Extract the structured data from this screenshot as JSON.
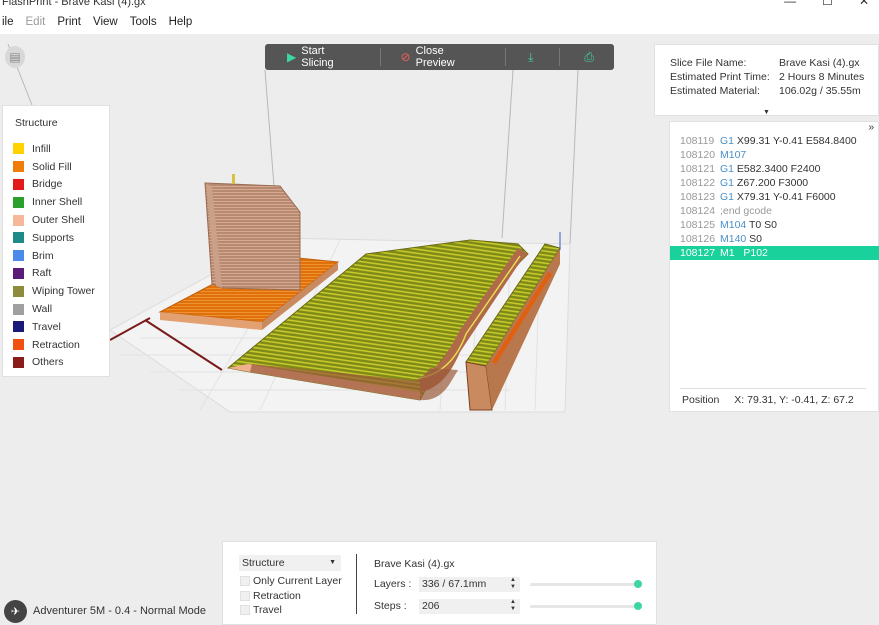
{
  "window": {
    "title": "FlashPrint - Brave Kasi (4).gx",
    "minimize": "—",
    "maximize": "☐",
    "close": "✕"
  },
  "menu": [
    {
      "label": "ile",
      "enabled": true
    },
    {
      "label": "Edit",
      "enabled": false
    },
    {
      "label": "Print",
      "enabled": true
    },
    {
      "label": "View",
      "enabled": true
    },
    {
      "label": "Tools",
      "enabled": true
    },
    {
      "label": "Help",
      "enabled": true
    }
  ],
  "toolbar": {
    "start_slicing": "Start Slicing",
    "close_preview": "Close Preview"
  },
  "structure": {
    "header": "Structure",
    "items": [
      {
        "label": "Infill",
        "color": "#ffd200"
      },
      {
        "label": "Solid Fill",
        "color": "#f07d0a"
      },
      {
        "label": "Bridge",
        "color": "#e31a1a"
      },
      {
        "label": "Inner Shell",
        "color": "#2ca02c"
      },
      {
        "label": "Outer Shell",
        "color": "#f7b89a"
      },
      {
        "label": "Supports",
        "color": "#1f8a8a"
      },
      {
        "label": "Brim",
        "color": "#4a8ae8"
      },
      {
        "label": "Raft",
        "color": "#5a1a78"
      },
      {
        "label": "Wiping Tower",
        "color": "#8c8c3c"
      },
      {
        "label": "Wall",
        "color": "#a0a0a0"
      },
      {
        "label": "Travel",
        "color": "#1a1a7a"
      },
      {
        "label": "Retraction",
        "color": "#f05010"
      },
      {
        "label": "Others",
        "color": "#8a1c1c"
      }
    ]
  },
  "slice_info": {
    "file_label": "Slice File Name:",
    "file_value": "Brave Kasi (4).gx",
    "time_label": "Estimated Print Time:",
    "time_value": "2 Hours 8 Minutes",
    "material_label": "Estimated Material:",
    "material_value": "106.02g / 35.55m"
  },
  "gcode": {
    "collapse": "»",
    "lines": [
      {
        "num": "108119",
        "cmd": "G1",
        "args": " X99.31 Y-0.41 E584.8400",
        "selected": false
      },
      {
        "num": "108120",
        "cmd": "M107",
        "args": "",
        "selected": false
      },
      {
        "num": "108121",
        "cmd": "G1",
        "args": " E582.3400 F2400",
        "selected": false
      },
      {
        "num": "108122",
        "cmd": "G1",
        "args": " Z67.200 F3000",
        "selected": false
      },
      {
        "num": "108123",
        "cmd": "G1",
        "args": " X79.31 Y-0.41 F6000",
        "selected": false
      },
      {
        "num": "108124",
        "cmd": "",
        "args": ";end gcode",
        "selected": false
      },
      {
        "num": "108125",
        "cmd": "M104",
        "args": " T0 S0",
        "selected": false
      },
      {
        "num": "108126",
        "cmd": "M140",
        "args": " S0",
        "selected": false
      },
      {
        "num": "108127",
        "cmd": "M1",
        "args": "   P102",
        "selected": true
      }
    ],
    "position_label": "Position",
    "position_value": "X: 79.31, Y: -0.41, Z: 67.2"
  },
  "bottom": {
    "view_mode": "Structure",
    "only_current_layer": "Only Current Layer",
    "retraction": "Retraction",
    "travel": "Travel",
    "file_name": "Brave Kasi (4).gx",
    "layers_label": "Layers :",
    "layers_value": "336 / 67.1mm",
    "steps_label": "Steps :",
    "steps_value": "206",
    "layers_slider_fraction": 1.0,
    "steps_slider_fraction": 1.0
  },
  "machine": {
    "label": "Adventurer 5M - 0.4 - Normal Mode"
  }
}
